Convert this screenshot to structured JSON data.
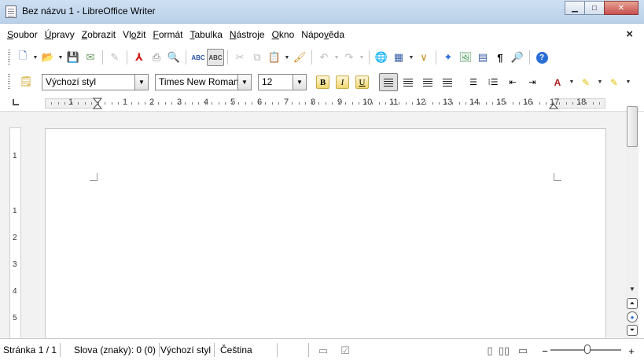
{
  "window": {
    "title": "Bez názvu 1 - LibreOffice Writer",
    "minimize_glyph": "▁",
    "maximize_glyph": "□",
    "close_glyph": "✕"
  },
  "menubar": {
    "items": [
      {
        "label_pre": "",
        "label_ul": "S",
        "label_post": "oubor"
      },
      {
        "label_pre": "",
        "label_ul": "Ú",
        "label_post": "pravy"
      },
      {
        "label_pre": "",
        "label_ul": "Z",
        "label_post": "obrazit"
      },
      {
        "label_pre": "Vl",
        "label_ul": "o",
        "label_post": "žit"
      },
      {
        "label_pre": "",
        "label_ul": "F",
        "label_post": "ormát"
      },
      {
        "label_pre": "",
        "label_ul": "T",
        "label_post": "abulka"
      },
      {
        "label_pre": "",
        "label_ul": "N",
        "label_post": "ástroje"
      },
      {
        "label_pre": "",
        "label_ul": "O",
        "label_post": "kno"
      },
      {
        "label_pre": "Nápo",
        "label_ul": "v",
        "label_post": "ěda"
      }
    ],
    "close_doc_glyph": "×"
  },
  "formatting": {
    "paragraph_style": "Výchozí styl",
    "font_name": "Times New Roman",
    "font_size": "12",
    "bold_label": "B",
    "italic_label": "I",
    "underline_label": "U",
    "dropdown_glyph": "▼"
  },
  "ruler": {
    "h_numbers": [
      "1",
      "1",
      "2",
      "3",
      "4",
      "5",
      "6",
      "7",
      "8",
      "9",
      "10",
      "11",
      "12",
      "13",
      "14",
      "15",
      "16",
      "17",
      "18"
    ],
    "v_numbers": [
      "1",
      "1",
      "2",
      "3",
      "4",
      "5"
    ]
  },
  "status": {
    "page": "Stránka 1 / 1",
    "words": "Slova (znaky): 0 (0)",
    "style": "Výchozí styl",
    "language": "Čeština"
  },
  "colors": {
    "title_bar": "#c4d8ee",
    "close_button": "#c75050",
    "help_icon": "#2a6fd6",
    "pdf_icon": "#d01818"
  }
}
